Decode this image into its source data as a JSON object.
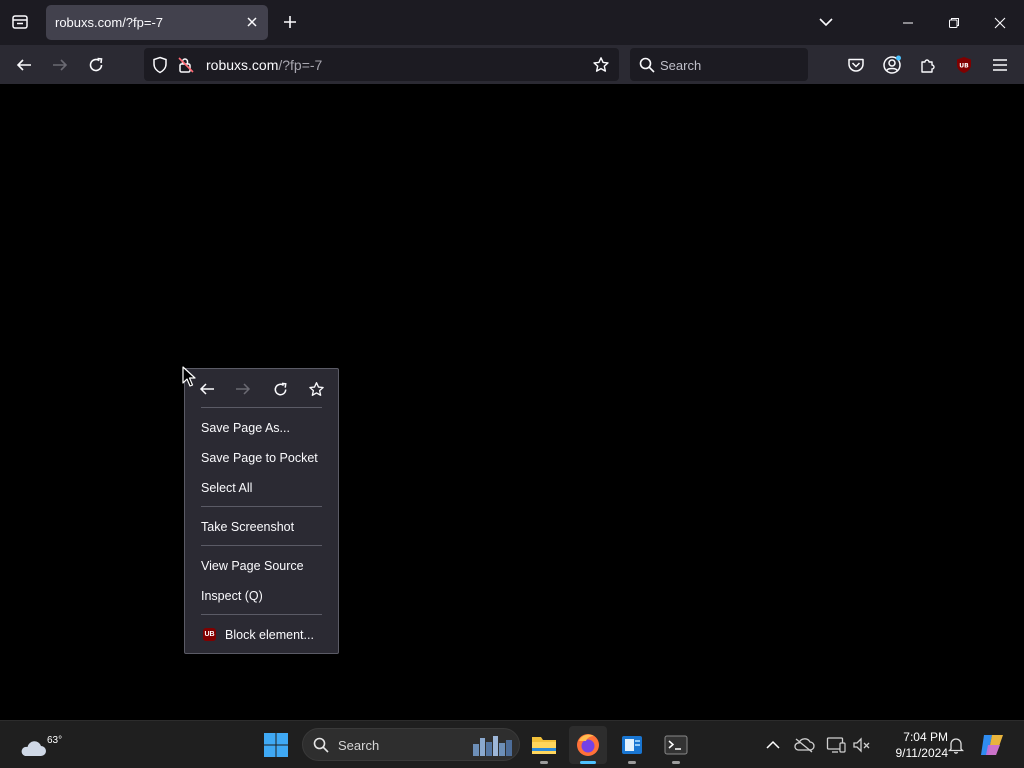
{
  "browser": {
    "tab": {
      "title": "robuxs.com/?fp=-7"
    },
    "url": {
      "host": "robuxs.com",
      "path": "/?fp=-7"
    },
    "search": {
      "placeholder": "Search"
    },
    "ublock_badge": "UB"
  },
  "context_menu": {
    "items": [
      {
        "label": "Save Page As..."
      },
      {
        "label": "Save Page to Pocket"
      },
      {
        "label": "Select All"
      },
      {
        "label": "Take Screenshot"
      },
      {
        "label": "View Page Source"
      },
      {
        "label": "Inspect (Q)"
      },
      {
        "label": "Block element..."
      }
    ]
  },
  "taskbar": {
    "weather": {
      "temp": "63°"
    },
    "search": {
      "label": "Search"
    },
    "clock": {
      "time": "7:04 PM",
      "date": "9/11/2024"
    }
  },
  "colors": {
    "tab_strip": "#1c1b22",
    "toolbar": "#2b2a33",
    "active_tab": "#42414d",
    "firefox_accent": "#4cc2ff"
  }
}
